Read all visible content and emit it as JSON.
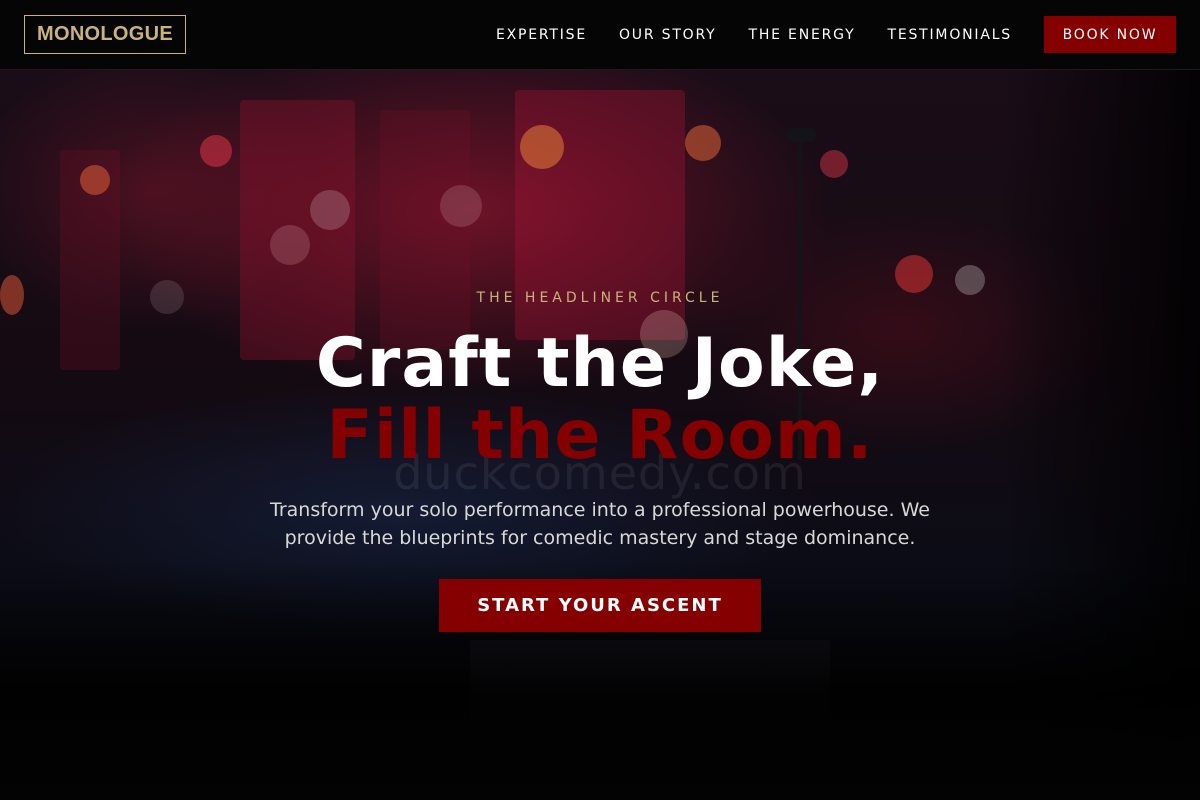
{
  "nav": {
    "logo": "MONOLOGUE",
    "links": [
      "EXPERTISE",
      "OUR STORY",
      "THE ENERGY",
      "TESTIMONIALS"
    ],
    "book_label": "BOOK NOW"
  },
  "hero": {
    "eyebrow": "THE HEADLINER CIRCLE",
    "headline_line1": "Craft the Joke,",
    "headline_line2": "Fill the Room.",
    "watermark": "duckcomedy.com",
    "subtext": "Transform your solo performance into a professional powerhouse. We provide the blueprints for comedic mastery and stage dominance.",
    "cta_label": "START YOUR ASCENT"
  },
  "colors": {
    "accent_red": "#850000",
    "gold": "#c9b37a",
    "background": "#050505"
  }
}
